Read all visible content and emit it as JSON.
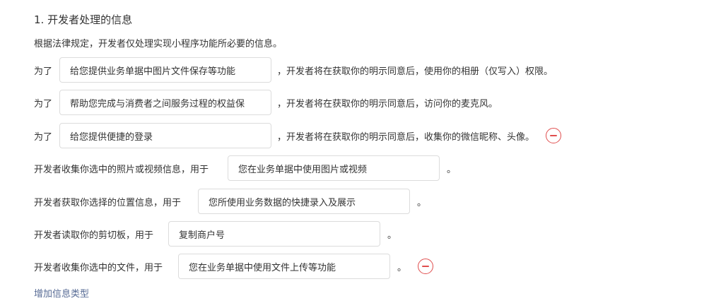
{
  "section": {
    "title": "1.  开发者处理的信息",
    "intro": "根据法律规定，开发者仅处理实现小程序功能所必要的信息。"
  },
  "rows": [
    {
      "prefix": "为了",
      "value": "给您提供业务单据中图片文件保存等功能",
      "suffix": "，开发者将在获取你的明示同意后，使用你的相册（仅写入）权限。"
    },
    {
      "prefix": "为了",
      "value": "帮助您完成与消费者之间服务过程的权益保",
      "suffix": "，开发者将在获取你的明示同意后，访问你的麦克风。"
    },
    {
      "prefix": "为了",
      "value": "给您提供便捷的登录",
      "suffix": "，开发者将在获取你的明示同意后，收集你的微信昵称、头像。"
    },
    {
      "prefix": "开发者收集你选中的照片或视频信息，用于",
      "value": "您在业务单据中使用图片或视频",
      "suffix": "。"
    },
    {
      "prefix": "开发者获取你选择的位置信息，用于",
      "value": "您所使用业务数据的快捷录入及展示",
      "suffix": "。"
    },
    {
      "prefix": "开发者读取你的剪切板，用于",
      "value": "复制商户号",
      "suffix": "。"
    },
    {
      "prefix": "开发者收集你选中的文件，用于",
      "value": "您在业务单据中使用文件上传等功能",
      "suffix": "。"
    }
  ],
  "actions": {
    "add_label": "增加信息类型",
    "remove_icon": "minus-circle-icon"
  },
  "colors": {
    "text": "#333333",
    "border": "#dcdcdc",
    "link": "#576b95",
    "danger": "#e04e4e"
  }
}
